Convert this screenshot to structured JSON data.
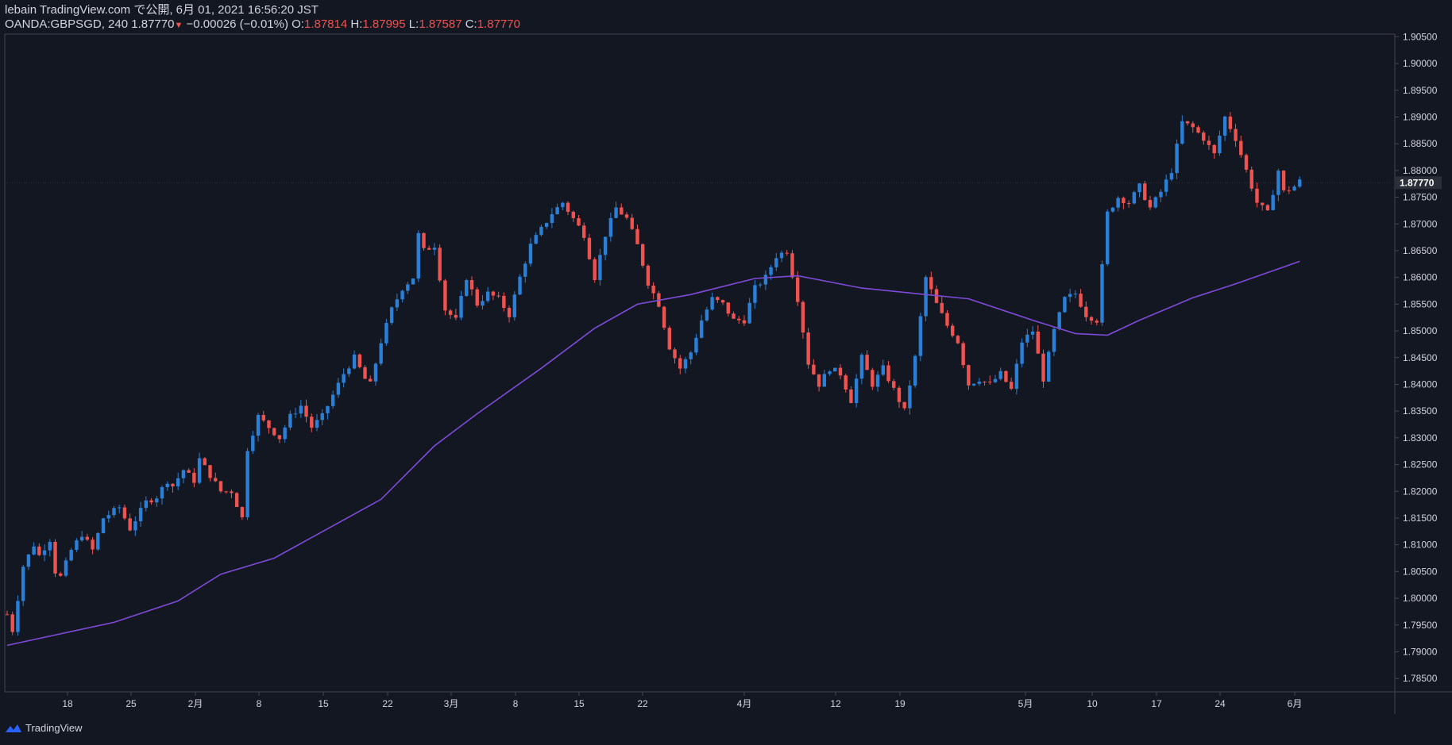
{
  "header": {
    "line1": "lebain TradingView.com で公開, 6月 01, 2021 16:56:20 JST",
    "symbol": "OANDA:GBPSGD, 240",
    "last": "1.87770",
    "change": "−0.00026 (−0.01%)",
    "o_label": "O:",
    "o": "1.87814",
    "h_label": "H:",
    "h": "1.87995",
    "l_label": "L:",
    "l": "1.87587",
    "c_label": "C:",
    "c": "1.87770"
  },
  "footer": {
    "brand": "TradingView",
    "icon": "tradingview-logo-icon"
  },
  "colors": {
    "bg": "#131722",
    "up": "#2a7fd6",
    "down": "#ef5350",
    "ma": "#7e4bd9",
    "text": "#d1d4dc",
    "axis": "#434651"
  },
  "chart_data": {
    "type": "candlestick",
    "title": "",
    "xlabel": "",
    "ylabel": "",
    "ylim": [
      1.7825,
      1.9055
    ],
    "y_ticks": [
      "1.90500",
      "1.90000",
      "1.89500",
      "1.89000",
      "1.88500",
      "1.88000",
      "1.87500",
      "1.87000",
      "1.86500",
      "1.86000",
      "1.85500",
      "1.85000",
      "1.84500",
      "1.84000",
      "1.83500",
      "1.83000",
      "1.82500",
      "1.82000",
      "1.81500",
      "1.81000",
      "1.80500",
      "1.80000",
      "1.79500",
      "1.79000",
      "1.78500"
    ],
    "last_price_label": "1.87770",
    "x_ticks": [
      "18",
      "25",
      "2月",
      "8",
      "15",
      "22",
      "3月",
      "8",
      "15",
      "22",
      "4月",
      "12",
      "19",
      "5月",
      "10",
      "17",
      "24",
      "6月"
    ],
    "price_path": [
      [
        0,
        1.797
      ],
      [
        1,
        1.794
      ],
      [
        2,
        1.8
      ],
      [
        3,
        1.806
      ],
      [
        5,
        1.81
      ],
      [
        6,
        1.808
      ],
      [
        8,
        1.811
      ],
      [
        9,
        1.805
      ],
      [
        10,
        1.804
      ],
      [
        12,
        1.809
      ],
      [
        14,
        1.812
      ],
      [
        16,
        1.809
      ],
      [
        18,
        1.815
      ],
      [
        21,
        1.817
      ],
      [
        23,
        1.813
      ],
      [
        26,
        1.818
      ],
      [
        28,
        1.819
      ],
      [
        30,
        1.822
      ],
      [
        31,
        1.821
      ],
      [
        33,
        1.824
      ],
      [
        35,
        1.822
      ],
      [
        36,
        1.826
      ],
      [
        38,
        1.823
      ],
      [
        40,
        1.82
      ],
      [
        42,
        1.82
      ],
      [
        44,
        1.815
      ],
      [
        45,
        1.828
      ],
      [
        47,
        1.834
      ],
      [
        49,
        1.832
      ],
      [
        51,
        1.83
      ],
      [
        53,
        1.834
      ],
      [
        55,
        1.836
      ],
      [
        57,
        1.832
      ],
      [
        59,
        1.834
      ],
      [
        61,
        1.838
      ],
      [
        63,
        1.842
      ],
      [
        65,
        1.845
      ],
      [
        67,
        1.841
      ],
      [
        68,
        1.84
      ],
      [
        70,
        1.848
      ],
      [
        72,
        1.854
      ],
      [
        74,
        1.858
      ],
      [
        76,
        1.86
      ],
      [
        77,
        1.868
      ],
      [
        78,
        1.865
      ],
      [
        80,
        1.866
      ],
      [
        82,
        1.854
      ],
      [
        84,
        1.852
      ],
      [
        86,
        1.86
      ],
      [
        88,
        1.855
      ],
      [
        90,
        1.857
      ],
      [
        92,
        1.856
      ],
      [
        94,
        1.853
      ],
      [
        96,
        1.86
      ],
      [
        98,
        1.866
      ],
      [
        100,
        1.869
      ],
      [
        102,
        1.872
      ],
      [
        104,
        1.874
      ],
      [
        106,
        1.871
      ],
      [
        108,
        1.868
      ],
      [
        110,
        1.86
      ],
      [
        112,
        1.868
      ],
      [
        114,
        1.873
      ],
      [
        116,
        1.871
      ],
      [
        118,
        1.866
      ],
      [
        120,
        1.859
      ],
      [
        122,
        1.855
      ],
      [
        124,
        1.847
      ],
      [
        126,
        1.843
      ],
      [
        128,
        1.846
      ],
      [
        130,
        1.852
      ],
      [
        132,
        1.856
      ],
      [
        134,
        1.855
      ],
      [
        136,
        1.852
      ],
      [
        138,
        1.852
      ],
      [
        140,
        1.858
      ],
      [
        142,
        1.86
      ],
      [
        144,
        1.864
      ],
      [
        146,
        1.865
      ],
      [
        148,
        1.856
      ],
      [
        150,
        1.844
      ],
      [
        152,
        1.84
      ],
      [
        154,
        1.843
      ],
      [
        156,
        1.842
      ],
      [
        158,
        1.837
      ],
      [
        160,
        1.845
      ],
      [
        162,
        1.84
      ],
      [
        164,
        1.843
      ],
      [
        166,
        1.839
      ],
      [
        168,
        1.835
      ],
      [
        170,
        1.845
      ],
      [
        172,
        1.86
      ],
      [
        174,
        1.855
      ],
      [
        176,
        1.851
      ],
      [
        178,
        1.848
      ],
      [
        180,
        1.84
      ],
      [
        182,
        1.841
      ],
      [
        184,
        1.84
      ],
      [
        186,
        1.842
      ],
      [
        188,
        1.839
      ],
      [
        190,
        1.848
      ],
      [
        192,
        1.85
      ],
      [
        194,
        1.841
      ],
      [
        196,
        1.85
      ],
      [
        198,
        1.856
      ],
      [
        200,
        1.857
      ],
      [
        202,
        1.853
      ],
      [
        204,
        1.852
      ],
      [
        206,
        1.872
      ],
      [
        208,
        1.875
      ],
      [
        210,
        1.874
      ],
      [
        212,
        1.877
      ],
      [
        214,
        1.873
      ],
      [
        216,
        1.876
      ],
      [
        218,
        1.88
      ],
      [
        220,
        1.889
      ],
      [
        222,
        1.888
      ],
      [
        224,
        1.886
      ],
      [
        226,
        1.883
      ],
      [
        228,
        1.89
      ],
      [
        230,
        1.886
      ],
      [
        232,
        1.88
      ],
      [
        234,
        1.874
      ],
      [
        236,
        1.872
      ],
      [
        238,
        1.88
      ],
      [
        239,
        1.876
      ],
      [
        241,
        1.877
      ],
      [
        242,
        1.878
      ]
    ],
    "ma_path": [
      [
        0,
        1.7912
      ],
      [
        20,
        1.7955
      ],
      [
        32,
        1.7995
      ],
      [
        40,
        1.8045
      ],
      [
        50,
        1.8075
      ],
      [
        60,
        1.813
      ],
      [
        70,
        1.8185
      ],
      [
        80,
        1.8285
      ],
      [
        88,
        1.8345
      ],
      [
        100,
        1.843
      ],
      [
        110,
        1.8505
      ],
      [
        118,
        1.855
      ],
      [
        128,
        1.8568
      ],
      [
        140,
        1.8598
      ],
      [
        148,
        1.8603
      ],
      [
        160,
        1.858
      ],
      [
        170,
        1.857
      ],
      [
        180,
        1.856
      ],
      [
        192,
        1.852
      ],
      [
        200,
        1.8495
      ],
      [
        206,
        1.8492
      ],
      [
        212,
        1.852
      ],
      [
        222,
        1.8562
      ],
      [
        230,
        1.8588
      ],
      [
        242,
        1.863
      ]
    ],
    "candle_count": 243,
    "legend": "none",
    "grid": false
  }
}
